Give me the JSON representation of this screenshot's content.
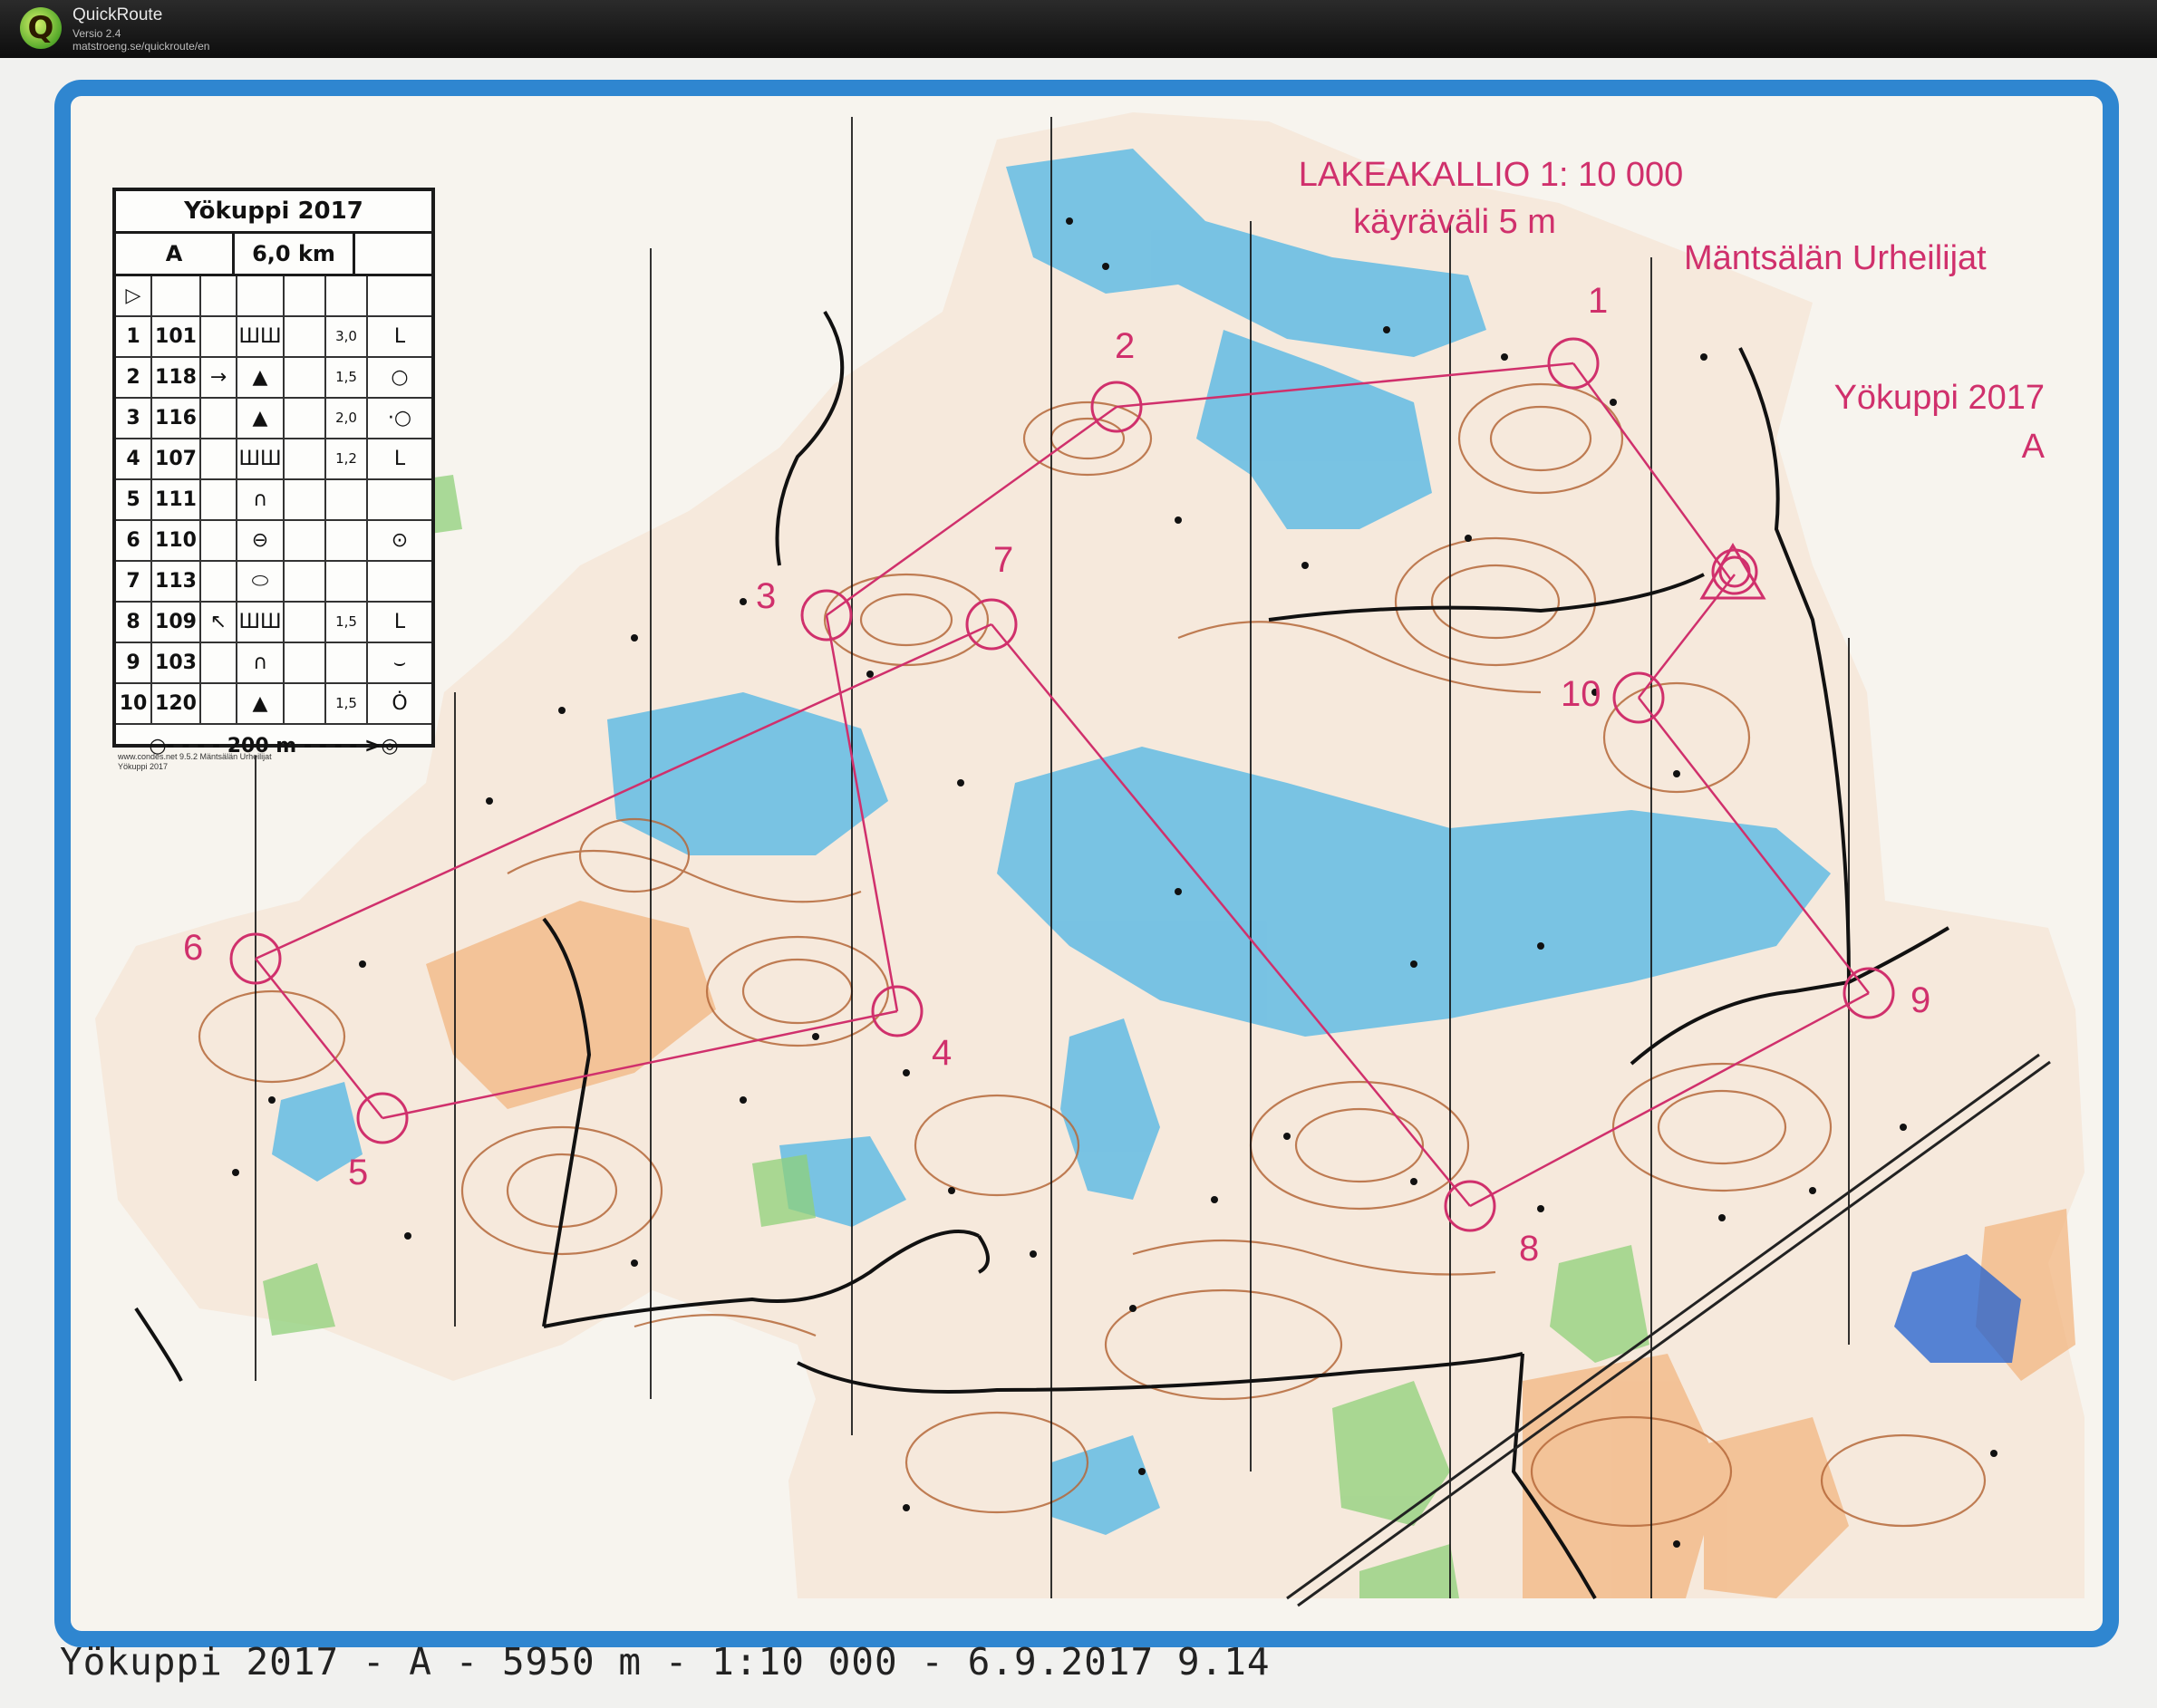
{
  "window": {
    "app_name": "QuickRoute",
    "version": "Versio 2.4",
    "url": "matstroeng.se/quickroute/en",
    "logo_letter": "Q"
  },
  "map_title": {
    "line1": "LAKEAKALLIO 1: 10 000",
    "line2": "käyräväli 5 m",
    "club": "Mäntsälän Urheilijat",
    "event": "Yökuppi 2017",
    "course": "A"
  },
  "legend": {
    "title": "Yökuppi 2017",
    "course": "A",
    "length": "6,0 km",
    "start_symbol": "▷",
    "rows": [
      {
        "num": "1",
        "code": "101",
        "dir": "",
        "feature": "ШШ",
        "size": "3,0",
        "detail": "L"
      },
      {
        "num": "2",
        "code": "118",
        "dir": "→",
        "feature": "▲",
        "size": "1,5",
        "detail": "○"
      },
      {
        "num": "3",
        "code": "116",
        "dir": "",
        "feature": "▲",
        "size": "2,0",
        "detail": "·○"
      },
      {
        "num": "4",
        "code": "107",
        "dir": "",
        "feature": "ШШ",
        "size": "1,2",
        "detail": "L"
      },
      {
        "num": "5",
        "code": "111",
        "dir": "",
        "feature": "∩",
        "size": "",
        "detail": ""
      },
      {
        "num": "6",
        "code": "110",
        "dir": "",
        "feature": "⊖",
        "size": "",
        "detail": "⊙"
      },
      {
        "num": "7",
        "code": "113",
        "dir": "",
        "feature": "⬭",
        "size": "",
        "detail": ""
      },
      {
        "num": "8",
        "code": "109",
        "dir": "↖",
        "feature": "ШШ",
        "size": "1,5",
        "detail": "L"
      },
      {
        "num": "9",
        "code": "103",
        "dir": "",
        "feature": "∩",
        "size": "",
        "detail": "⌣"
      },
      {
        "num": "10",
        "code": "120",
        "dir": "",
        "feature": "▲",
        "size": "1,5",
        "detail": "Ȯ"
      }
    ],
    "finish": "○- - - - 200 m - - - - >◎",
    "credit1": "www.condes.net 9.5.2 Mäntsälän Urheilijat",
    "credit2": "Yökuppi 2017"
  },
  "controls": [
    {
      "label": "1"
    },
    {
      "label": "2"
    },
    {
      "label": "3"
    },
    {
      "label": "4"
    },
    {
      "label": "5"
    },
    {
      "label": "6"
    },
    {
      "label": "7"
    },
    {
      "label": "8"
    },
    {
      "label": "9"
    },
    {
      "label": "10"
    }
  ],
  "footer": "Yökuppi 2017 - A - 5950 m - 1:10 000 - 6.9.2017 9.14",
  "colors": {
    "frame": "#2f86d0",
    "course": "#d0306c",
    "water": "#4fb6e6",
    "contour": "#b5683a",
    "open": "#f2b27a",
    "vegetation": "#8fd07a",
    "titlebar": "#111111"
  }
}
